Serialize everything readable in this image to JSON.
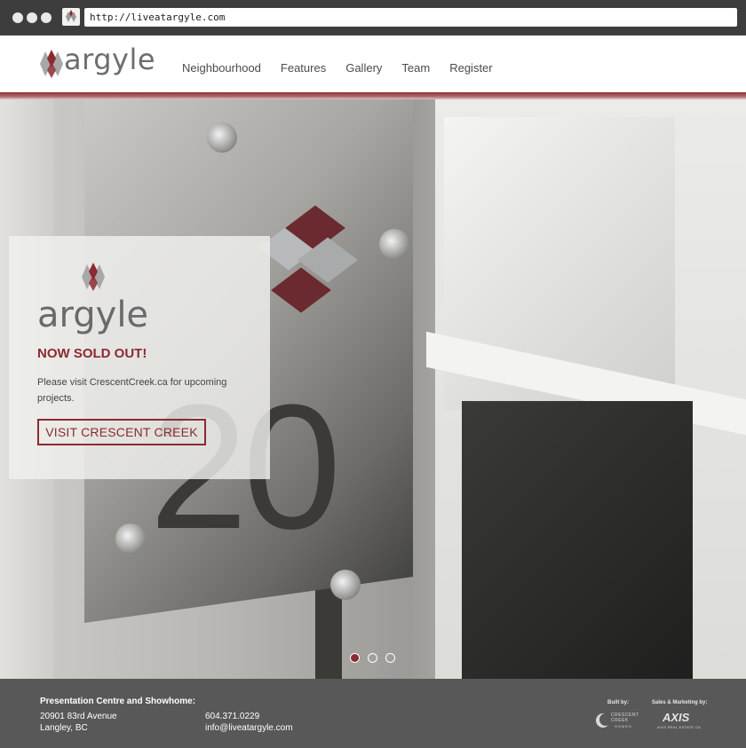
{
  "browser": {
    "url": "http://liveatargyle.com"
  },
  "header": {
    "logo_text": "argyle",
    "nav": [
      {
        "label": "Neighbourhood"
      },
      {
        "label": "Features"
      },
      {
        "label": "Gallery"
      },
      {
        "label": "Team"
      },
      {
        "label": "Register"
      }
    ]
  },
  "hero": {
    "plate_number": "20",
    "card": {
      "logo_text": "argyle",
      "title": "NOW SOLD OUT!",
      "body": "Please visit CrescentCreek.ca for upcoming projects.",
      "button_label": "VISIT CRESCENT CREEK"
    },
    "carousel": {
      "slide_count": 3,
      "active_index": 0
    }
  },
  "footer": {
    "label": "Presentation Centre and Showhome:",
    "address_line1": "20901 83rd Avenue",
    "address_line2": "Langley, BC",
    "phone": "604.371.0229",
    "email": "info@liveatargyle.com",
    "built_by_label": "Built by:",
    "builder_name": "CRESCENT CREEK",
    "builder_sub": "HOMES",
    "marketing_label": "Sales & Marketing by:",
    "marketing_name": "AXIS",
    "marketing_sub": "AXIS REAL ESTATE CA"
  },
  "colors": {
    "brand_red": "#8b2a30",
    "chrome": "#3d3d3d",
    "footer": "#585858",
    "logo_gray": "#6d6d6d"
  }
}
